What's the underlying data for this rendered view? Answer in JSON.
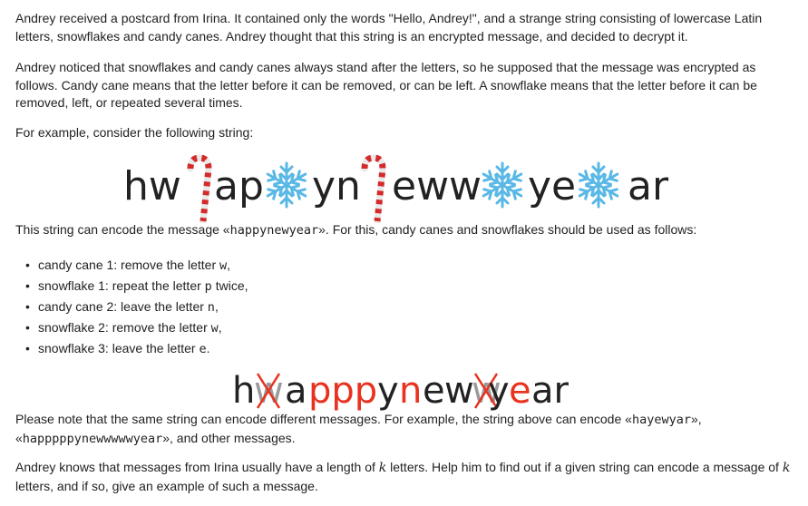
{
  "paragraphs": {
    "p1": "Andrey received a postcard from Irina. It contained only the words \"Hello, Andrey!\", and a strange string consisting of lowercase Latin letters, snowflakes and candy canes. Andrey thought that this string is an encrypted message, and decided to decrypt it.",
    "p2": "Andrey noticed that snowflakes and candy canes always stand after the letters, so he supposed that the message was encrypted as follows. Candy cane means that the letter before it can be removed, or can be left. A snowflake means that the letter before it can be removed, left, or repeated several times.",
    "p3": "For example, consider the following string:",
    "p4_before": "This string can encode the message «",
    "p4_code": "happynewyear",
    "p4_after": "». For this, candy canes and snowflakes should be used as follows:",
    "p5_a": "Please note that the same string can encode different messages. For example, the string above can encode «",
    "p5_code1": "hayewyar",
    "p5_b": "»,",
    "p5_c": "«",
    "p5_code2": "happpppynewwwwwyear",
    "p5_d": "», and other messages.",
    "p6_a": "Andrey knows that messages from Irina usually have a length of ",
    "p6_k1": "k",
    "p6_b": " letters. Help him to find out if a given string can encode a message of ",
    "p6_k2": "k",
    "p6_c": "letters, and if so, give an example of such a message."
  },
  "rules": [
    {
      "before": "candy cane 1: remove the letter ",
      "code": "w",
      "after": ","
    },
    {
      "before": "snowflake 1: repeat the letter ",
      "code": "p",
      "after": " twice,"
    },
    {
      "before": "candy cane 2: leave the letter ",
      "code": "n",
      "after": ","
    },
    {
      "before": "snowflake 2: remove the letter ",
      "code": "w",
      "after": ","
    },
    {
      "before": "snowflake 3: leave the letter ",
      "code": "e",
      "after": "."
    }
  ],
  "figure1": {
    "t1": "hw",
    "t2": "ap",
    "t3": "yn",
    "t4": "eww",
    "t5": "ye",
    "t6": "ar"
  },
  "figure2": {
    "h": "h",
    "w1": "w",
    "a": "a",
    "ppp": "ppp",
    "y1": "y",
    "n": "n",
    "e1": "e",
    "w2": "w",
    "w3": "w",
    "y2": "y",
    "e2": "e",
    "ar": "ar"
  },
  "colors": {
    "text": "#222222",
    "cane_red": "#d42a2a",
    "snowflake": "#5ab8e6",
    "highlight_red": "#e8321f",
    "removed_gray": "#9a9a9a"
  }
}
